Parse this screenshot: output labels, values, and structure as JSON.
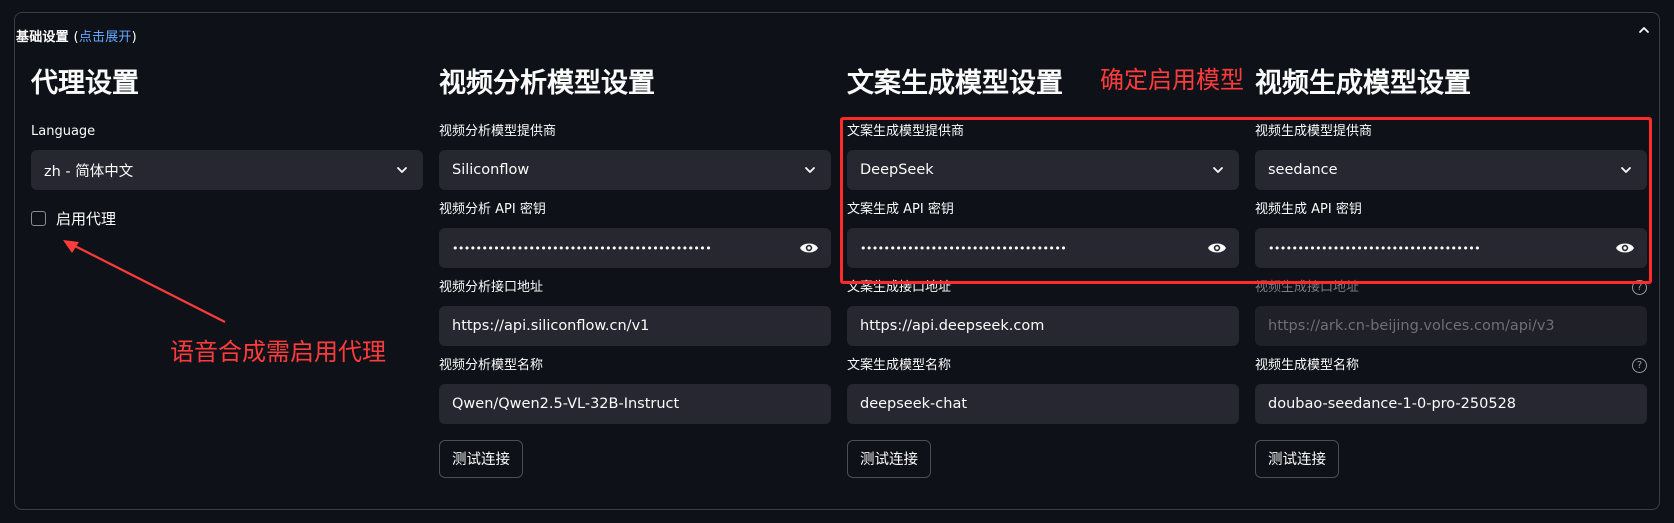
{
  "expander": {
    "title": "基础设置",
    "hint_open": "(",
    "hint": "点击展开",
    "hint_close": ")",
    "collapse_icon": "chevron-up-icon"
  },
  "proxy": {
    "heading": "代理设置",
    "language_label": "Language",
    "language_value": "zh - 简体中文",
    "enable_proxy_label": "启用代理",
    "enable_proxy_checked": false
  },
  "video_analysis": {
    "heading": "视频分析模型设置",
    "provider_label": "视频分析模型提供商",
    "provider_value": "Siliconflow",
    "api_key_label": "视频分析 API 密钥",
    "api_key_value": "••••••••••••••••••••••••••••••••••••••••••••••••••••",
    "endpoint_label": "视频分析接口地址",
    "endpoint_value": "https://api.siliconflow.cn/v1",
    "model_label": "视频分析模型名称",
    "model_value": "Qwen/Qwen2.5-VL-32B-Instruct",
    "test_button": "测试连接"
  },
  "copywriting": {
    "heading": "文案生成模型设置",
    "provider_label": "文案生成模型提供商",
    "provider_value": "DeepSeek",
    "api_key_label": "文案生成 API 密钥",
    "api_key_value": "•••••••••••••••••••••••••••••••••••",
    "endpoint_label": "文案生成接口地址",
    "endpoint_value": "https://api.deepseek.com",
    "model_label": "文案生成模型名称",
    "model_value": "deepseek-chat",
    "test_button": "测试连接"
  },
  "video_generation": {
    "heading": "视频生成模型设置",
    "provider_label": "视频生成模型提供商",
    "provider_value": "seedance",
    "api_key_label": "视频生成 API 密钥",
    "api_key_value": "••••••••••••••••••••••••••••••••••••",
    "endpoint_label": "视频生成接口地址",
    "endpoint_placeholder": "https://ark.cn-beijing.volces.com/api/v3",
    "model_label": "视频生成模型名称",
    "model_value": "doubao-seedance-1-0-pro-250528",
    "test_button": "测试连接"
  },
  "annotations": {
    "confirm_model": "确定启用模型",
    "proxy_note": "语音合成需启用代理",
    "color": "#ff3b3b"
  },
  "colors": {
    "background": "#0e1117",
    "input_bg": "#262730",
    "link": "#62a8ff",
    "annotation": "#ff2a2a"
  }
}
